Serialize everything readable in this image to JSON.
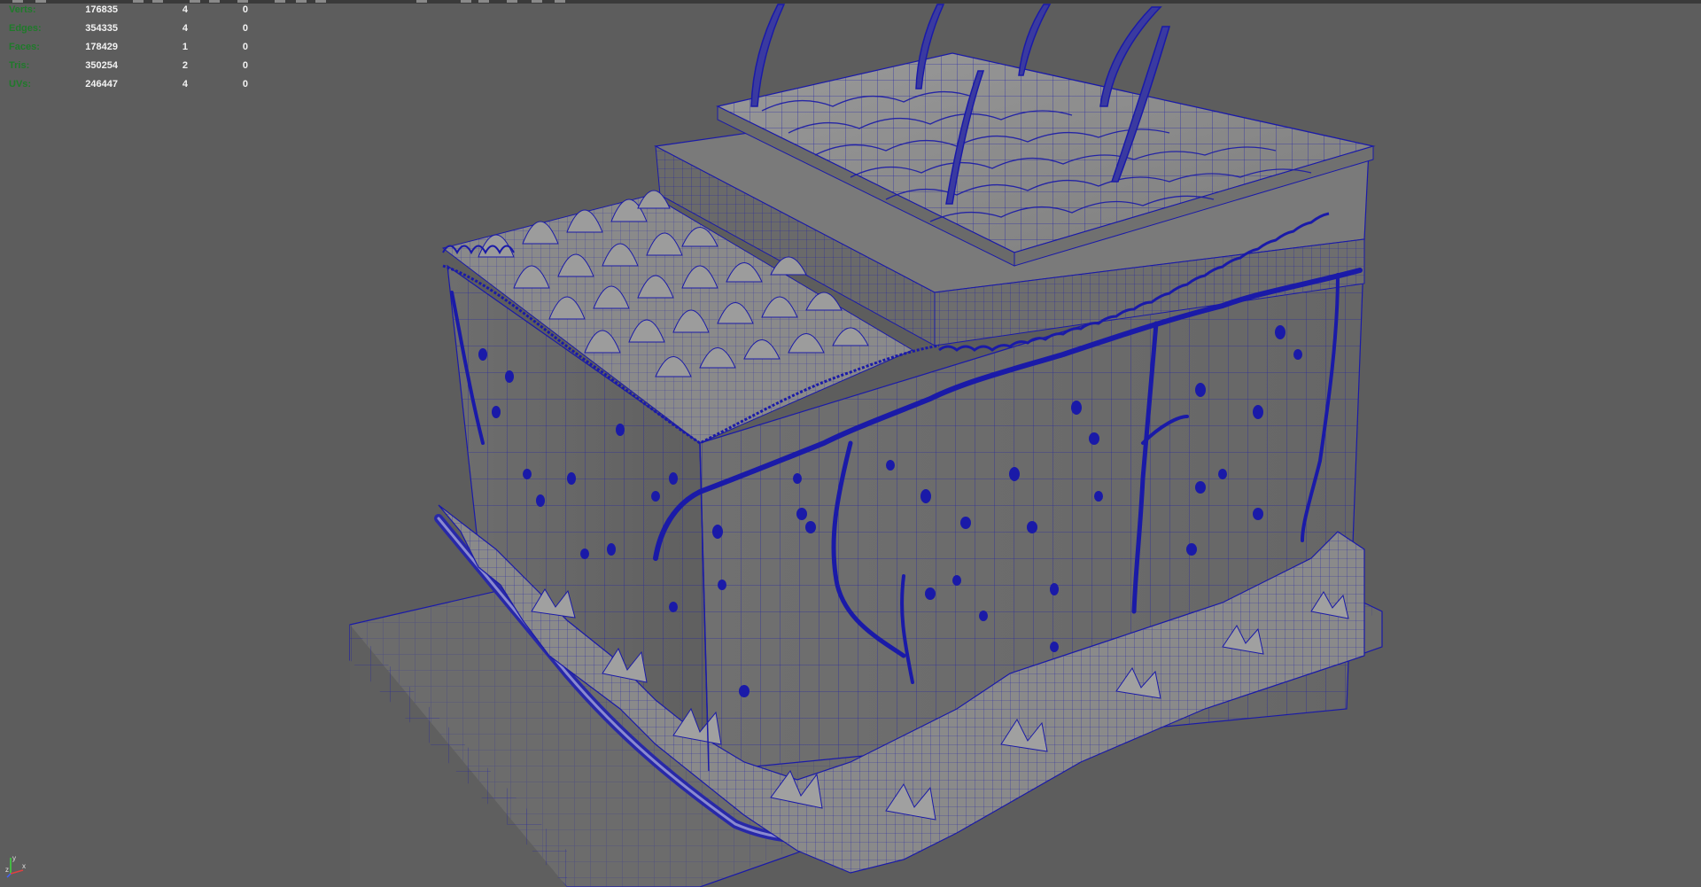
{
  "hud": {
    "rows": [
      {
        "label": "Verts:",
        "values": [
          "176835",
          "4",
          "0"
        ]
      },
      {
        "label": "Edges:",
        "values": [
          "354335",
          "4",
          "0"
        ]
      },
      {
        "label": "Faces:",
        "values": [
          "178429",
          "1",
          "0"
        ]
      },
      {
        "label": "Tris:",
        "values": [
          "350254",
          "2",
          "0"
        ]
      },
      {
        "label": "UVs:",
        "values": [
          "246447",
          "4",
          "0"
        ]
      }
    ]
  },
  "axis": {
    "x_label": "x",
    "y_label": "y",
    "z_label": "z"
  },
  "colors": {
    "viewport_bg": "#5d5d5d",
    "hud_label": "#1f7a2a",
    "hud_value": "#f2f2f2",
    "wireframe": "#1a1aa8",
    "surface": "#7a7a7a"
  },
  "icons": [
    "toolbar-icons",
    "axis-gizmo-icon"
  ]
}
